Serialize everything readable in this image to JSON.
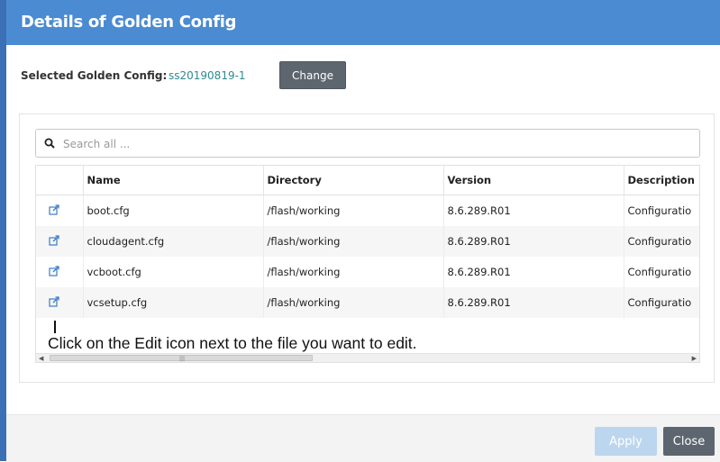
{
  "dialog": {
    "title": "Details of Golden Config",
    "selected_label": "Selected Golden Config:",
    "selected_value": "ss20190819-1",
    "change_label": "Change"
  },
  "search": {
    "placeholder": "Search all ...",
    "icon": "search-icon"
  },
  "table": {
    "columns": [
      "",
      "Name",
      "Directory",
      "Version",
      "Description"
    ],
    "rows": [
      {
        "icon": "edit-icon",
        "name": "boot.cfg",
        "directory": "/flash/working",
        "version": "8.6.289.R01",
        "description": "Configuratio"
      },
      {
        "icon": "edit-icon",
        "name": "cloudagent.cfg",
        "directory": "/flash/working",
        "version": "8.6.289.R01",
        "description": "Configuratio"
      },
      {
        "icon": "edit-icon",
        "name": "vcboot.cfg",
        "directory": "/flash/working",
        "version": "8.6.289.R01",
        "description": "Configuratio"
      },
      {
        "icon": "edit-icon",
        "name": "vcsetup.cfg",
        "directory": "/flash/working",
        "version": "8.6.289.R01",
        "description": "Configuratio"
      }
    ]
  },
  "caption": "Click on the Edit icon next to the file you want to edit.",
  "footer": {
    "apply_label": "Apply",
    "close_label": "Close"
  },
  "colors": {
    "header_blue": "#4a8bd1",
    "accent_teal": "#2f8a8f",
    "button_gray": "#5d666f",
    "apply_disabled": "#bcd6ef"
  }
}
